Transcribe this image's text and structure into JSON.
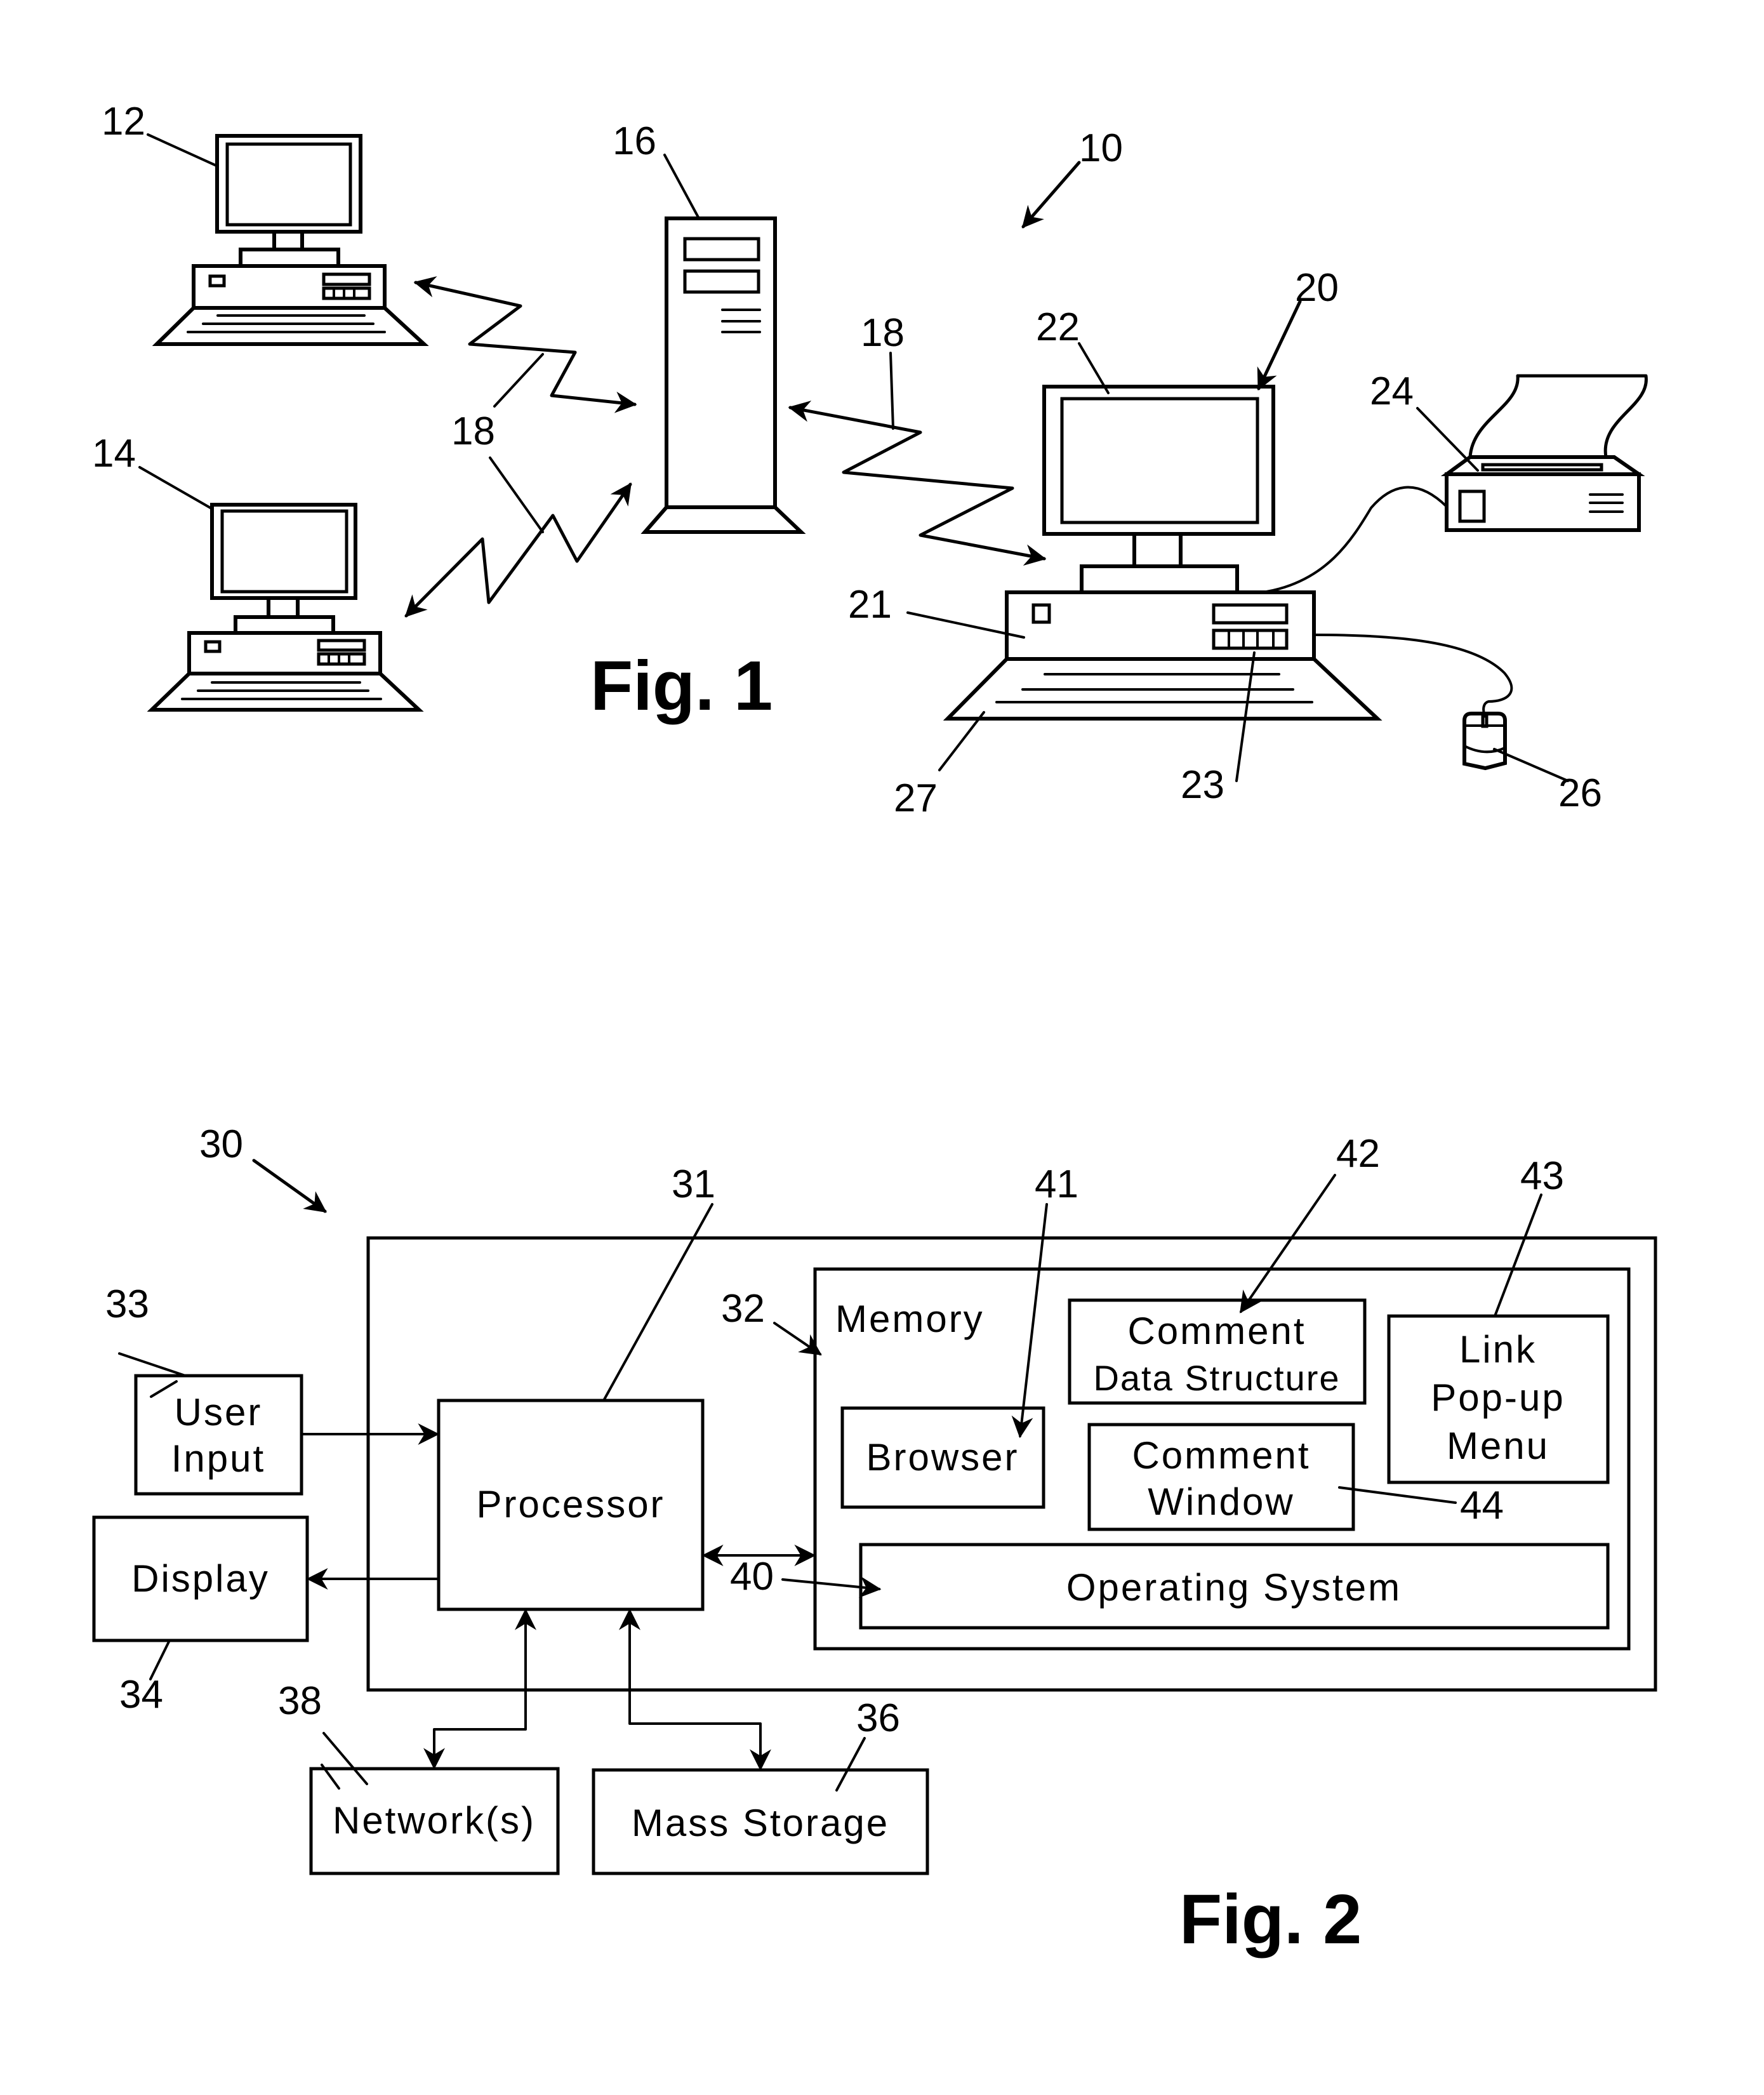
{
  "figure1": {
    "caption": "Fig. 1",
    "refs": {
      "system": "10",
      "client_top": "12",
      "client_bottom": "14",
      "server": "16",
      "link_left": "18",
      "link_right": "18",
      "workstation": "20",
      "cpu": "21",
      "monitor": "22",
      "drive_buttons": "23",
      "printer": "24",
      "mouse": "26",
      "keyboard": "27"
    }
  },
  "figure2": {
    "caption": "Fig. 2",
    "refs": {
      "system": "30",
      "processor": "31",
      "memory": "32",
      "user_input": "33",
      "display": "34",
      "mass_storage": "36",
      "networks": "38",
      "operating_system": "40",
      "browser": "41",
      "comment_data_structure": "42",
      "link_popup_menu": "43",
      "comment_window": "44"
    },
    "blocks": {
      "user_input": [
        "User",
        "Input"
      ],
      "display": "Display",
      "processor": "Processor",
      "memory": "Memory",
      "browser": "Browser",
      "comment_data_structure": [
        "Comment",
        "Data Structure"
      ],
      "comment_window": [
        "Comment",
        "Window"
      ],
      "link_popup_menu": [
        "Link",
        "Pop-up",
        "Menu"
      ],
      "operating_system": "Operating System",
      "networks": "Network(s)",
      "mass_storage": "Mass Storage"
    }
  }
}
